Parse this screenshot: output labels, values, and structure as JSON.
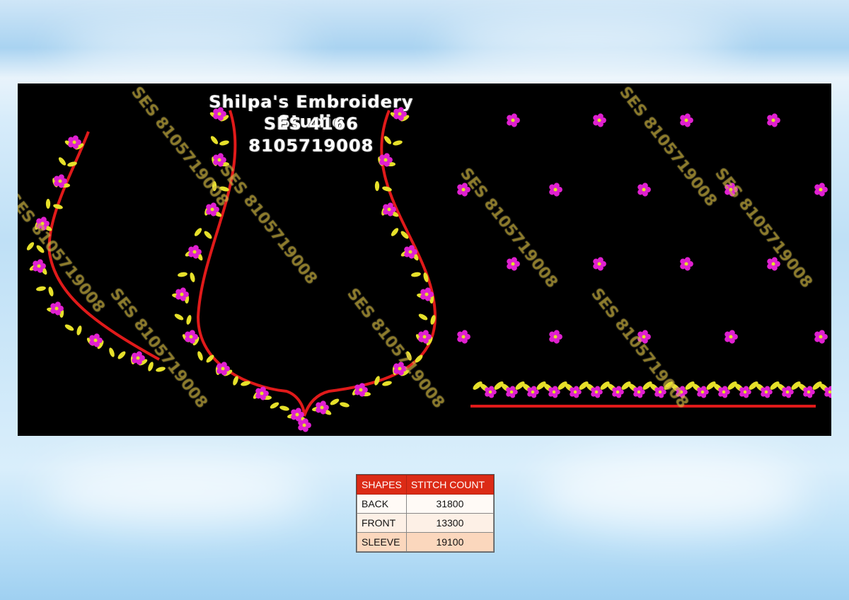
{
  "design": {
    "studio_name": "Shilpa's Embroidery Studio",
    "design_code": "SES 4166",
    "phone": "8105719008",
    "watermark": "SES 8105719008",
    "colors": {
      "background": "#000000",
      "outline": "#e01a1a",
      "flower": "#e020d0",
      "leaf": "#e6e02a"
    }
  },
  "stitch_table": {
    "headers": [
      "SHAPES",
      "STITCH COUNT"
    ],
    "rows": [
      {
        "shape": "BACK",
        "count": "31800"
      },
      {
        "shape": "FRONT",
        "count": "13300"
      },
      {
        "shape": "SLEEVE",
        "count": "19100"
      }
    ],
    "colors": {
      "header": "#dc2b16"
    }
  }
}
